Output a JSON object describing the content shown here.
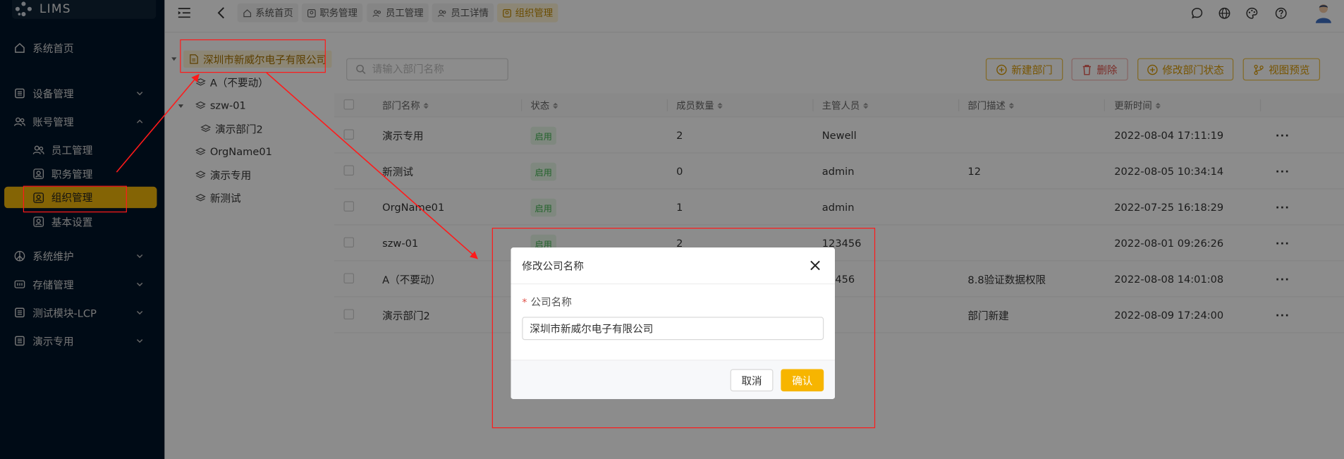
{
  "app": {
    "brand": "LIMS"
  },
  "sidebar": {
    "items": [
      {
        "label": "系统首页",
        "icon": "home-icon"
      },
      {
        "label": "设备管理",
        "icon": "grid-icon"
      },
      {
        "label": "账号管理",
        "icon": "users-icon"
      },
      {
        "label": "员工管理",
        "icon": "users-icon"
      },
      {
        "label": "职务管理",
        "icon": "id-card-icon"
      },
      {
        "label": "组织管理",
        "icon": "id-card-icon"
      },
      {
        "label": "基本设置",
        "icon": "id-card-icon"
      },
      {
        "label": "系统维护",
        "icon": "peace-icon"
      },
      {
        "label": "存储管理",
        "icon": "storage-icon"
      },
      {
        "label": "测试模块-LCP",
        "icon": "grid-icon"
      },
      {
        "label": "演示专用",
        "icon": "grid-icon"
      }
    ]
  },
  "tabs": [
    "系统首页",
    "职务管理",
    "员工管理",
    "员工详情",
    "组织管理"
  ],
  "tree": {
    "root": "深圳市新威尔电子有限公司",
    "nodes": [
      "A（不要动）",
      "szw-01",
      "演示部门2",
      "OrgName01",
      "演示专用",
      "新测试"
    ]
  },
  "toolbar": {
    "search_placeholder": "请输入部门名称",
    "new_dept": "新建部门",
    "delete": "删除",
    "edit_status": "修改部门状态",
    "view_preview": "视图预览"
  },
  "table": {
    "headers": [
      "部门名称",
      "状态",
      "成员数量",
      "主管人员",
      "部门描述",
      "更新时间"
    ],
    "rows": [
      {
        "name": "演示专用",
        "status": "启用",
        "count": "2",
        "manager": "Newell",
        "desc": "",
        "time": "2022-08-04 17:11:19"
      },
      {
        "name": "新测试",
        "status": "启用",
        "count": "0",
        "manager": "admin",
        "desc": "12",
        "time": "2022-08-05 10:34:14"
      },
      {
        "name": "OrgName01",
        "status": "启用",
        "count": "1",
        "manager": "admin",
        "desc": "",
        "time": "2022-07-25 16:18:29"
      },
      {
        "name": "szw-01",
        "status": "启用",
        "count": "2",
        "manager": "123456",
        "desc": "",
        "time": "2022-08-01 09:26:26"
      },
      {
        "name": "A（不要动）",
        "status": "",
        "count": "",
        "manager": "23456",
        "desc": "8.8验证数据权限",
        "time": "2022-08-08 14:01:08"
      },
      {
        "name": "演示部门2",
        "status": "",
        "count": "",
        "manager": "",
        "desc": "部门新建",
        "time": "2022-08-09 17:24:00"
      }
    ],
    "more": "···"
  },
  "modal": {
    "title": "修改公司名称",
    "field_required": "*",
    "field_label": "公司名称",
    "field_value": "深圳市新威尔电子有限公司",
    "cancel": "取消",
    "confirm": "确认"
  },
  "colors": {
    "accent": "#f7b500",
    "sidebar_bg": "#001529",
    "annotation": "#ff1a1a",
    "status_green": "#3fb34f"
  }
}
